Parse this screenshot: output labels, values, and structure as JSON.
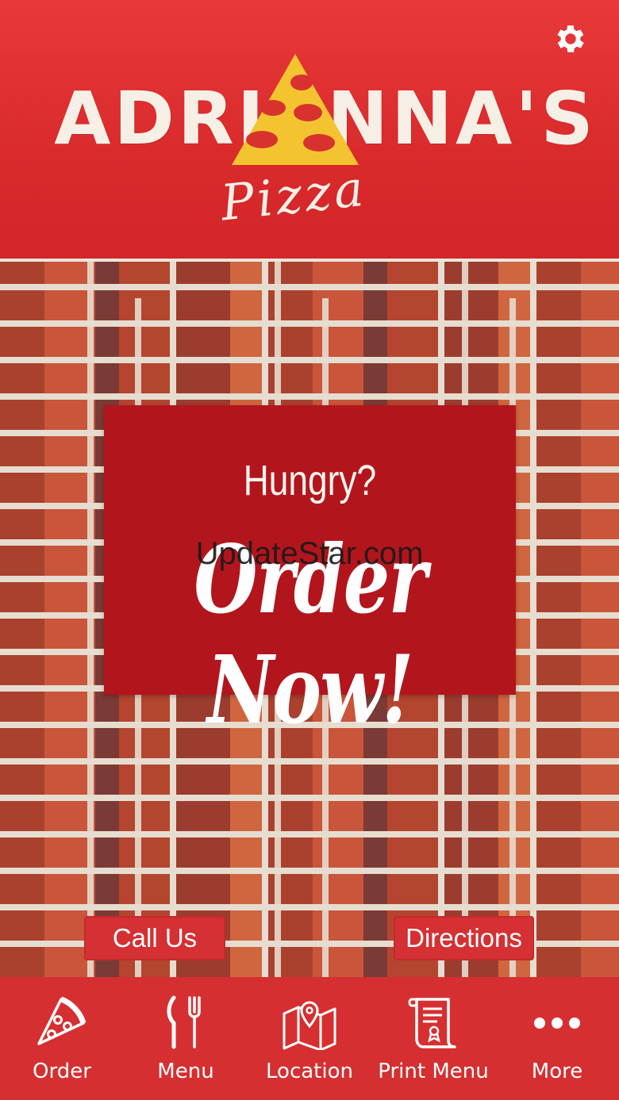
{
  "header": {
    "logo_text": "ADRIANNA'S",
    "logo_script": "Pizza",
    "settings_icon": "gear-icon"
  },
  "banner": {
    "line1": "Hungry?",
    "line2": "Order Now!"
  },
  "watermark": "UpdateStar.com",
  "actions": {
    "call_label": "Call Us",
    "directions_label": "Directions"
  },
  "tabs": [
    {
      "label": "Order",
      "icon": "pizza-slice-icon"
    },
    {
      "label": "Menu",
      "icon": "fork-knife-icon"
    },
    {
      "label": "Location",
      "icon": "map-pin-icon"
    },
    {
      "label": "Print Menu",
      "icon": "scroll-icon"
    },
    {
      "label": "More",
      "icon": "more-dots-icon"
    }
  ],
  "colors": {
    "brand_red": "#d62f31",
    "banner_red": "#b3151d",
    "cream": "#f6efe6",
    "pizza_yellow": "#f4c430"
  }
}
